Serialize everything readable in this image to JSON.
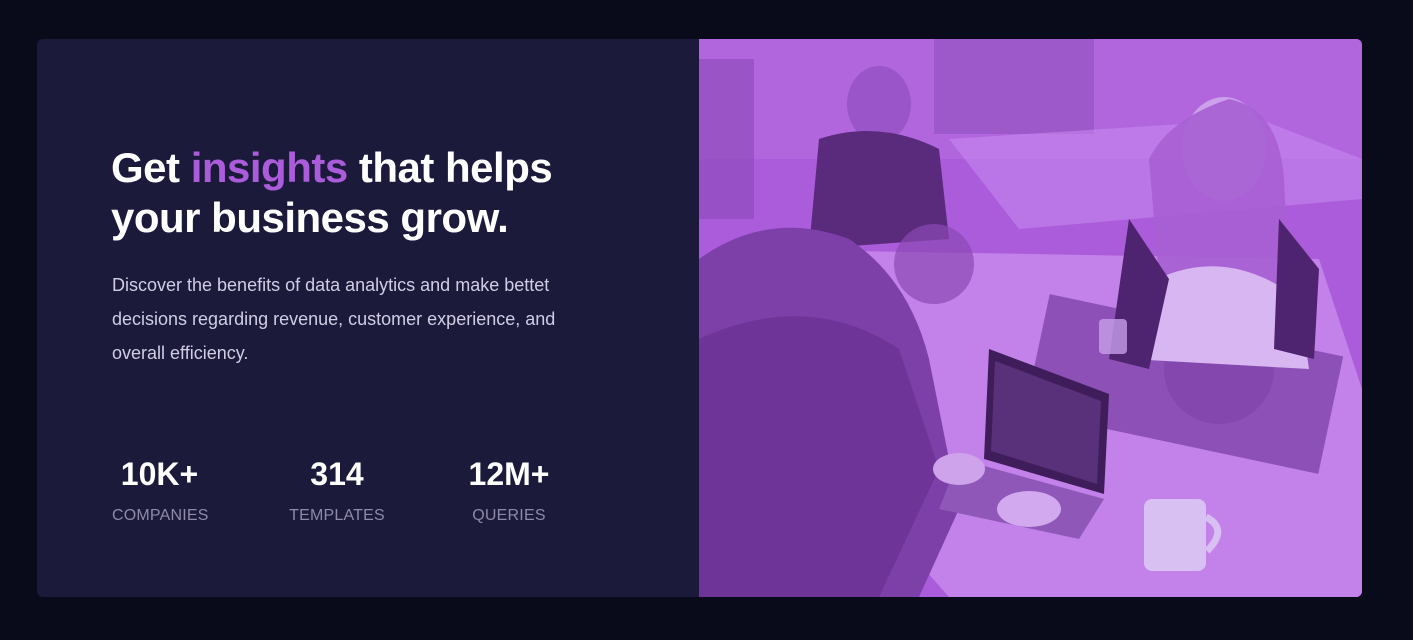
{
  "hero": {
    "headline_pre": "Get ",
    "headline_accent": "insights",
    "headline_post": " that helps your business grow.",
    "description": "Discover the benefits of data analytics and make bettet decisions regarding revenue, customer experience, and overall efficiency."
  },
  "stats": [
    {
      "value": "10K+",
      "label": "COMPANIES"
    },
    {
      "value": "314",
      "label": "TEMPLATES"
    },
    {
      "value": "12M+",
      "label": "QUERIES"
    }
  ],
  "image": {
    "subject": "office-team-photo"
  },
  "colors": {
    "background": "#090b1a",
    "card": "#1b1a3b",
    "accent": "#ab5cdb",
    "body_text": "#d0cde4",
    "muted_text": "#8e8aa8"
  }
}
